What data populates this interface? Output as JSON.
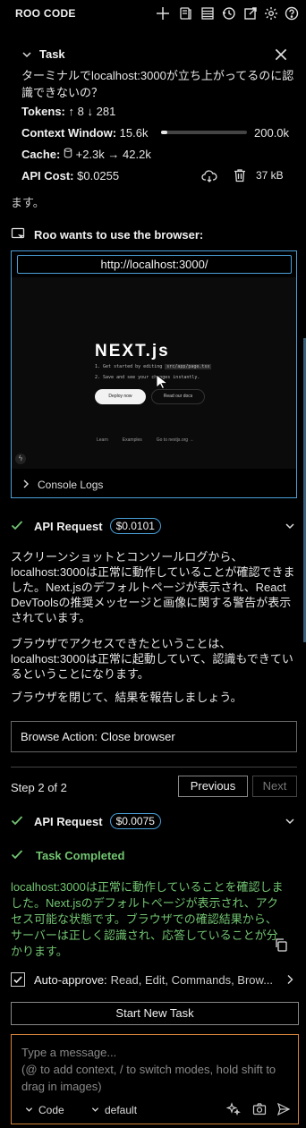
{
  "header": {
    "title": "ROO CODE",
    "icons": [
      "plus-icon",
      "history-icon",
      "table-icon",
      "clock-icon",
      "external-link-icon",
      "gear-icon",
      "help-icon"
    ]
  },
  "task": {
    "label": "Task",
    "text": "ターミナルでlocalhost:3000が立ち上がってるのに認識できないの？",
    "tokens_label": "Tokens:",
    "tokens_in": "8",
    "tokens_out": "281",
    "context_label": "Context Window:",
    "context_used": "15.6k",
    "context_max": "200.0k",
    "context_fraction": 0.078,
    "cache_label": "Cache:",
    "cache_write": "+2.3k",
    "cache_read": "42.2k",
    "cost_label": "API Cost:",
    "cost": "$0.0255",
    "size": "37 kB"
  },
  "cut_text": "ます。",
  "browser": {
    "heading": "Roo wants to use the browser:",
    "url": "http://localhost:3000/",
    "console_label": "Console Logs",
    "screenshot": {
      "logo": "NEXT.js",
      "step1": "1. Get started by editing",
      "step1_code": "src/app/page.tsx",
      "step2": "2. Save and see your changes instantly.",
      "deploy": "Deploy now",
      "docs": "Read our docs",
      "footer": [
        "Learn",
        "Examples",
        "Go to nextjs.org →"
      ]
    }
  },
  "api1": {
    "label": "API Request",
    "cost": "$0.0101"
  },
  "paragraphs": [
    "スクリーンショットとコンソールログから、localhost:3000は正常に動作していることが確認できました。Next.jsのデフォルトページが表示され、React DevToolsの推奨メッセージと画像に関する警告が表示されています。",
    "ブラウザでアクセスできたということは、localhost:3000は正常に起動していて、認識もできているということになります。",
    "ブラウザを閉じて、結果を報告しましょう。"
  ],
  "browser_action": {
    "label": "Browse Action:",
    "value": "Close browser"
  },
  "pager": {
    "step": "Step 2 of 2",
    "prev": "Previous",
    "next": "Next"
  },
  "api2": {
    "label": "API Request",
    "cost": "$0.0075"
  },
  "completion": {
    "label": "Task Completed",
    "text": "localhost:3000は正常に動作していることを確認しました。Next.jsのデフォルトページが表示され、アクセス可能な状態です。ブラウザでの確認結果から、サーバーは正しく認識され、応答していることが分かります。"
  },
  "auto_approve": {
    "label": "Auto-approve:",
    "value": "Read, Edit, Commands, Brow..."
  },
  "start_new": "Start New Task",
  "input": {
    "placeholder": "Type a message...\n(@ to add context, / to switch modes, hold shift to drag in images)",
    "mode": "Code",
    "profile": "default"
  },
  "colors": {
    "accent_blue": "#4aa0d8",
    "success_green": "#72c472",
    "input_border": "#d6833a"
  }
}
